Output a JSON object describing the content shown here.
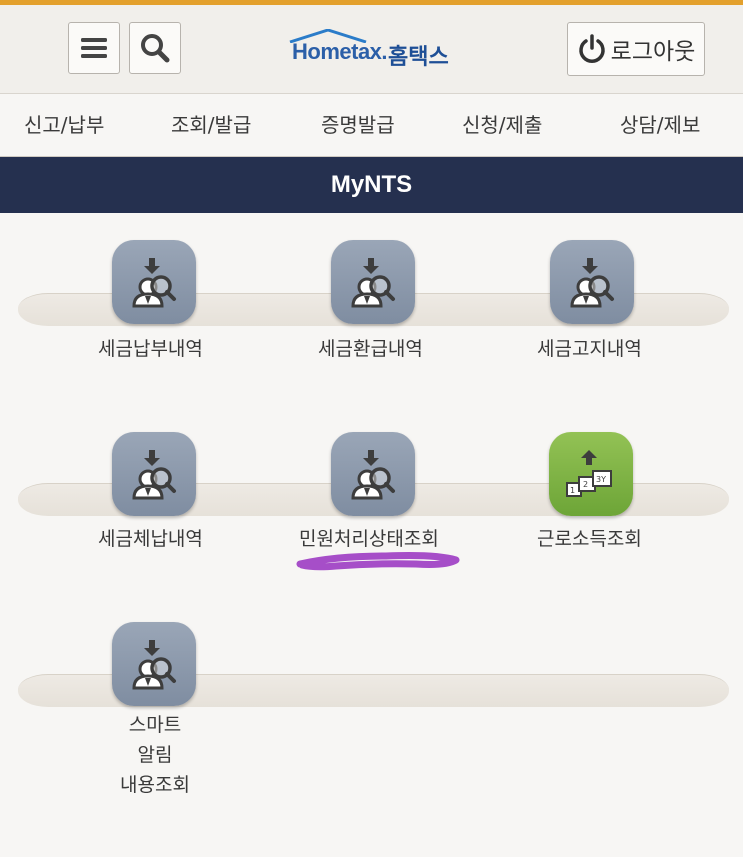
{
  "header": {
    "logo_text_en": "Hometax.",
    "logo_text_ko": "홈택스",
    "menu_icon": "hamburger-menu-icon",
    "search_icon": "search-icon",
    "logout_label": "로그아웃",
    "logout_icon": "power-icon"
  },
  "nav": {
    "items": [
      {
        "label": "신고/납부"
      },
      {
        "label": "조회/발급"
      },
      {
        "label": "증명발급"
      },
      {
        "label": "신청/제출"
      },
      {
        "label": "상담/제보"
      }
    ]
  },
  "banner": {
    "title": "MyNTS"
  },
  "menu": {
    "items": [
      {
        "label": "세금납부내역",
        "icon": "download-search-person-icon"
      },
      {
        "label": "세금환급내역",
        "icon": "download-search-person-icon"
      },
      {
        "label": "세금고지내역",
        "icon": "download-search-person-icon"
      },
      {
        "label": "세금체납내역",
        "icon": "download-search-person-icon"
      },
      {
        "label": "민원처리상태조회",
        "icon": "download-search-person-icon"
      },
      {
        "label": "근로소득조회",
        "icon": "upload-documents-icon"
      },
      {
        "label_lines": [
          "스마트",
          "알림",
          "내용조회"
        ],
        "icon": "download-search-person-icon"
      }
    ]
  },
  "colors": {
    "top_accent": "#e3a02c",
    "banner_bg": "#25304f",
    "tile_gray": "#8d99ac",
    "tile_green": "#7fb446",
    "annotation_underline": "#a64ec8"
  }
}
